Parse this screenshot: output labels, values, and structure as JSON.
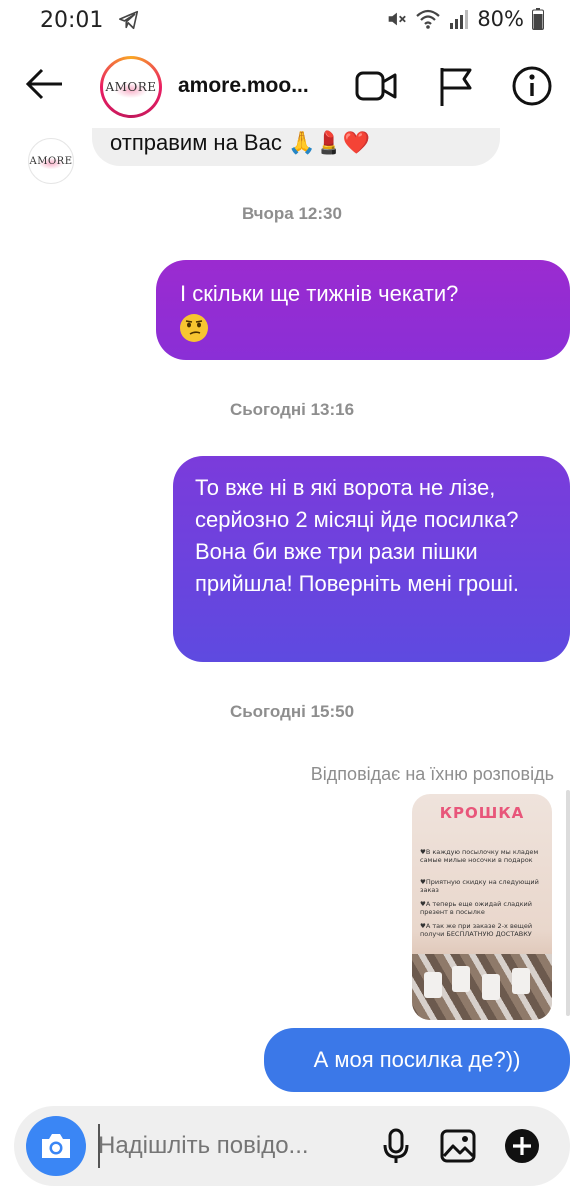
{
  "status_bar": {
    "time": "20:01",
    "battery": "80%"
  },
  "header": {
    "title": "amore.moo...",
    "avatar_text": "AMORE"
  },
  "messages": {
    "incoming_partial": "отправим на Вас 🙏💄❤️",
    "ts1": "Вчора 12:30",
    "out1": "І скільки ще тижнів чекати?",
    "ts2": "Сьогодні 13:16",
    "out2": "То вже ні в які ворота не лізе, серйозно 2 місяці йде посилка? Вона би вже три рази пішки прийшла! Поверніть мені гроші.",
    "ts3": "Сьогодні 15:50",
    "reply_note": "Відповідає на їхню розповідь",
    "out3": "А моя посилка де?))"
  },
  "story": {
    "title": "КРОШКА",
    "lines": [
      "♥В каждую посылочку мы кладем самые милые носочки в подарок",
      "♥Приятную скидку на следующий заказ",
      "♥А теперь еще ожидай сладкий презент в посылке",
      "♥А так же при заказе 2-х вещей получи БЕСПЛАТНУЮ ДОСТАВКУ"
    ]
  },
  "composer": {
    "placeholder": "Надішліть повідо..."
  },
  "colors": {
    "bubble_purple": "#9b2bd0",
    "bubble_violet": "#6a45de",
    "bubble_blue": "#3b78e8",
    "camera_blue": "#3a86f5"
  },
  "icons": [
    "back-arrow-icon",
    "video-call-icon",
    "flag-icon",
    "info-icon",
    "camera-icon",
    "microphone-icon",
    "gallery-icon",
    "add-icon",
    "telegram-icon",
    "wifi-icon",
    "signal-icon",
    "mute-icon",
    "battery-icon"
  ]
}
